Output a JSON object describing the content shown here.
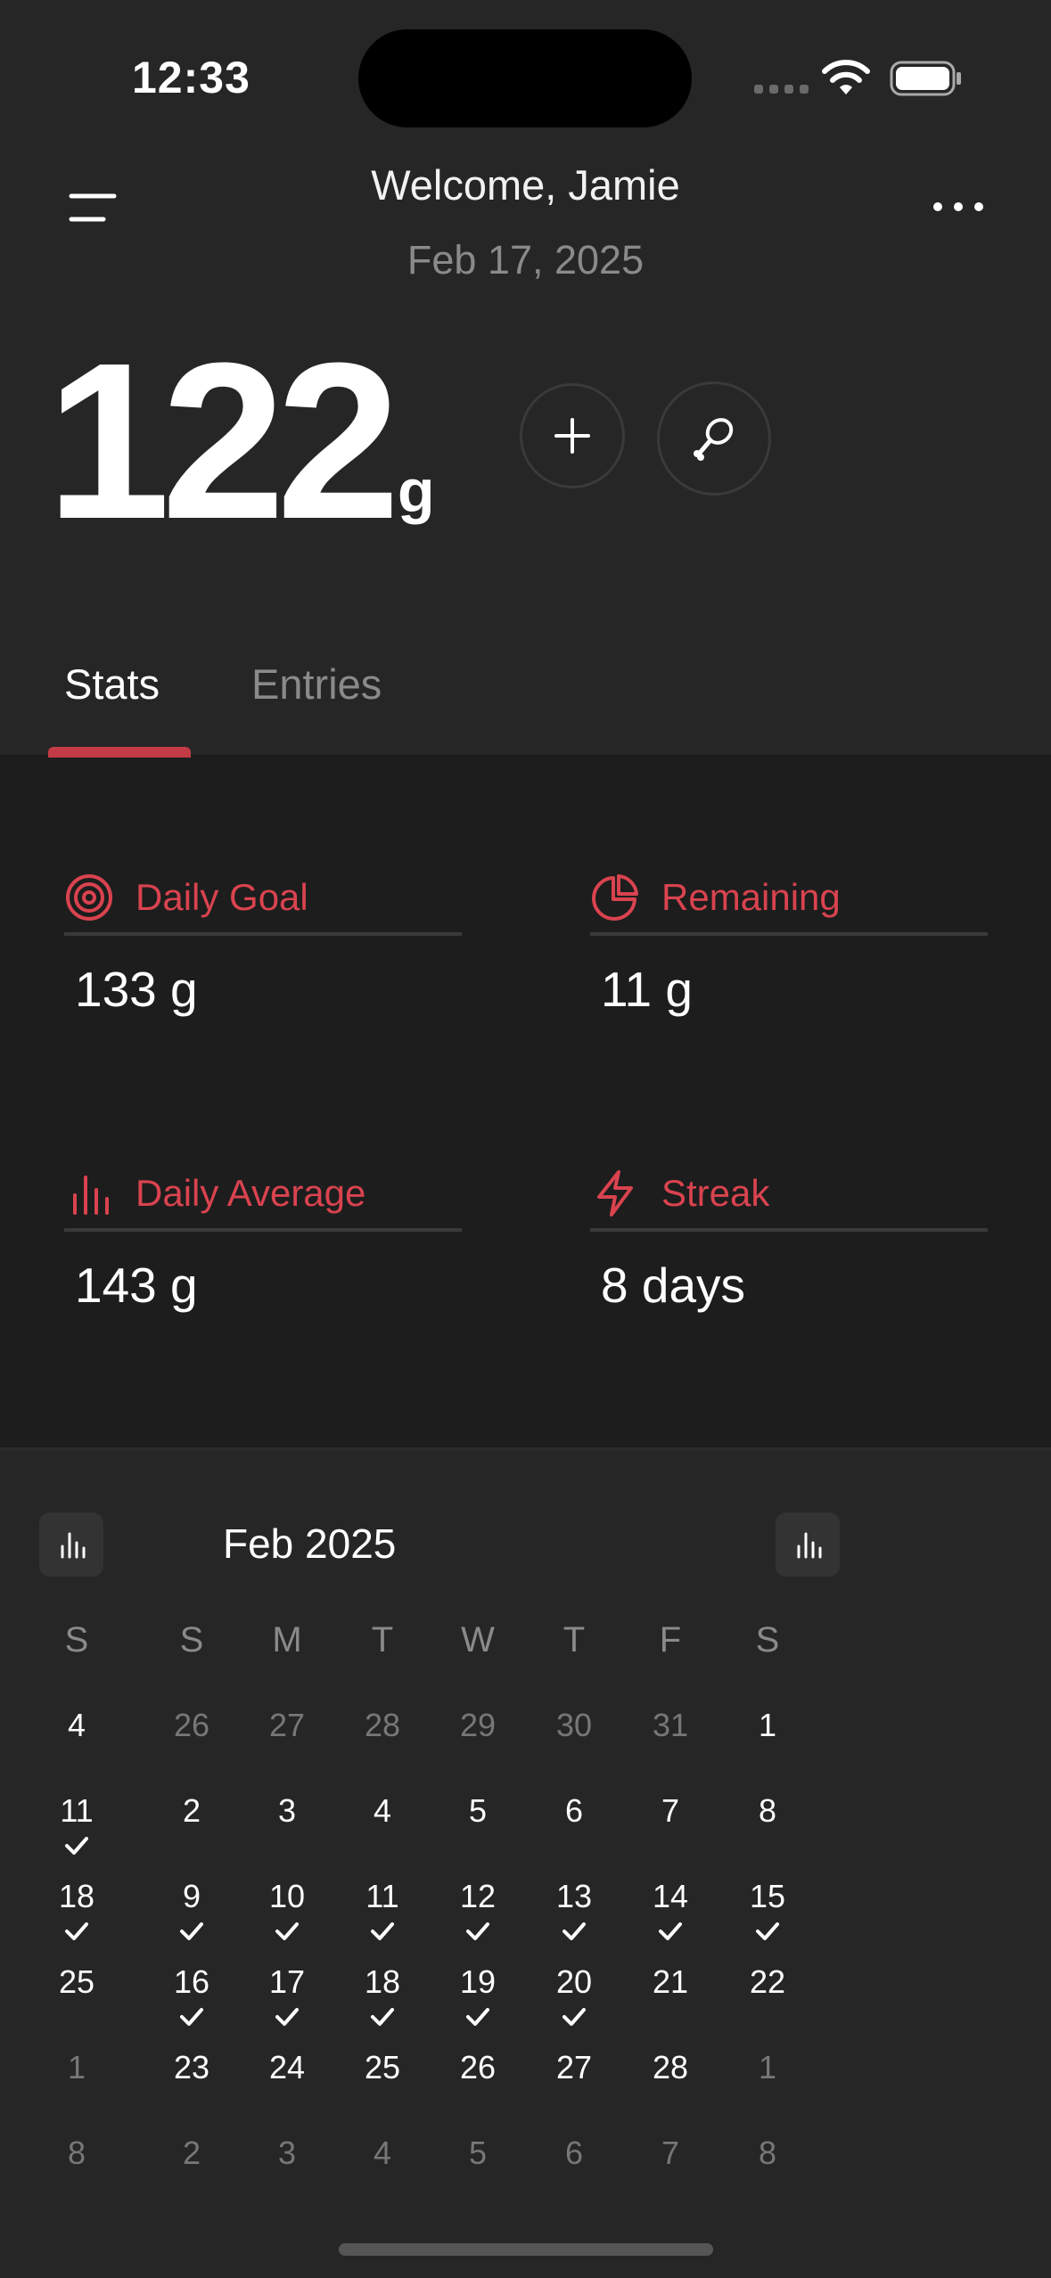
{
  "status": {
    "time": "12:33"
  },
  "header": {
    "title": "Welcome, Jamie",
    "date": "Feb 17, 2025"
  },
  "hero": {
    "value": "122",
    "unit": "g"
  },
  "tabs": [
    {
      "label": "Stats"
    },
    {
      "label": "Entries"
    }
  ],
  "stats": [
    {
      "label": "Daily Goal",
      "value": "133 g",
      "icon": "target-icon"
    },
    {
      "label": "Remaining",
      "value": "11 g",
      "icon": "pie-icon"
    },
    {
      "label": "Daily Average",
      "value": "143 g",
      "icon": "bar-chart-icon"
    },
    {
      "label": "Streak",
      "value": "8 days",
      "icon": "lightning-icon"
    }
  ],
  "calendar": {
    "title": "Feb 2025",
    "weekday_labels": [
      "S",
      "M",
      "T",
      "W",
      "T",
      "F",
      "S"
    ],
    "week_summary_header": "S",
    "week_summary": [
      {
        "day": "4",
        "dim": false,
        "checked": false
      },
      {
        "day": "11",
        "dim": false,
        "checked": true
      },
      {
        "day": "18",
        "dim": false,
        "checked": true
      },
      {
        "day": "25",
        "dim": false,
        "checked": false
      },
      {
        "day": "1",
        "dim": true,
        "checked": false
      },
      {
        "day": "8",
        "dim": true,
        "checked": false
      }
    ],
    "weeks": [
      [
        {
          "d": "26",
          "dim": true,
          "c": false
        },
        {
          "d": "27",
          "dim": true,
          "c": false
        },
        {
          "d": "28",
          "dim": true,
          "c": false
        },
        {
          "d": "29",
          "dim": true,
          "c": false
        },
        {
          "d": "30",
          "dim": true,
          "c": false
        },
        {
          "d": "31",
          "dim": true,
          "c": false
        },
        {
          "d": "1",
          "dim": false,
          "c": false
        }
      ],
      [
        {
          "d": "2",
          "dim": false,
          "c": false
        },
        {
          "d": "3",
          "dim": false,
          "c": false
        },
        {
          "d": "4",
          "dim": false,
          "c": false
        },
        {
          "d": "5",
          "dim": false,
          "c": false
        },
        {
          "d": "6",
          "dim": false,
          "c": false
        },
        {
          "d": "7",
          "dim": false,
          "c": false
        },
        {
          "d": "8",
          "dim": false,
          "c": false
        }
      ],
      [
        {
          "d": "9",
          "dim": false,
          "c": true
        },
        {
          "d": "10",
          "dim": false,
          "c": true
        },
        {
          "d": "11",
          "dim": false,
          "c": true
        },
        {
          "d": "12",
          "dim": false,
          "c": true
        },
        {
          "d": "13",
          "dim": false,
          "c": true
        },
        {
          "d": "14",
          "dim": false,
          "c": true
        },
        {
          "d": "15",
          "dim": false,
          "c": true
        }
      ],
      [
        {
          "d": "16",
          "dim": false,
          "c": true
        },
        {
          "d": "17",
          "dim": false,
          "c": true
        },
        {
          "d": "18",
          "dim": false,
          "c": true
        },
        {
          "d": "19",
          "dim": false,
          "c": true
        },
        {
          "d": "20",
          "dim": false,
          "c": true
        },
        {
          "d": "21",
          "dim": false,
          "c": false
        },
        {
          "d": "22",
          "dim": false,
          "c": false
        }
      ],
      [
        {
          "d": "23",
          "dim": false,
          "c": false
        },
        {
          "d": "24",
          "dim": false,
          "c": false
        },
        {
          "d": "25",
          "dim": false,
          "c": false
        },
        {
          "d": "26",
          "dim": false,
          "c": false
        },
        {
          "d": "27",
          "dim": false,
          "c": false
        },
        {
          "d": "28",
          "dim": false,
          "c": false
        },
        {
          "d": "1",
          "dim": true,
          "c": false
        }
      ],
      [
        {
          "d": "2",
          "dim": true,
          "c": false
        },
        {
          "d": "3",
          "dim": true,
          "c": false
        },
        {
          "d": "4",
          "dim": true,
          "c": false
        },
        {
          "d": "5",
          "dim": true,
          "c": false
        },
        {
          "d": "6",
          "dim": true,
          "c": false
        },
        {
          "d": "7",
          "dim": true,
          "c": false
        },
        {
          "d": "8",
          "dim": true,
          "c": false
        }
      ]
    ]
  },
  "colors": {
    "accent": "#d9434f",
    "background": "#262626",
    "panel": "#1d1d1d"
  }
}
